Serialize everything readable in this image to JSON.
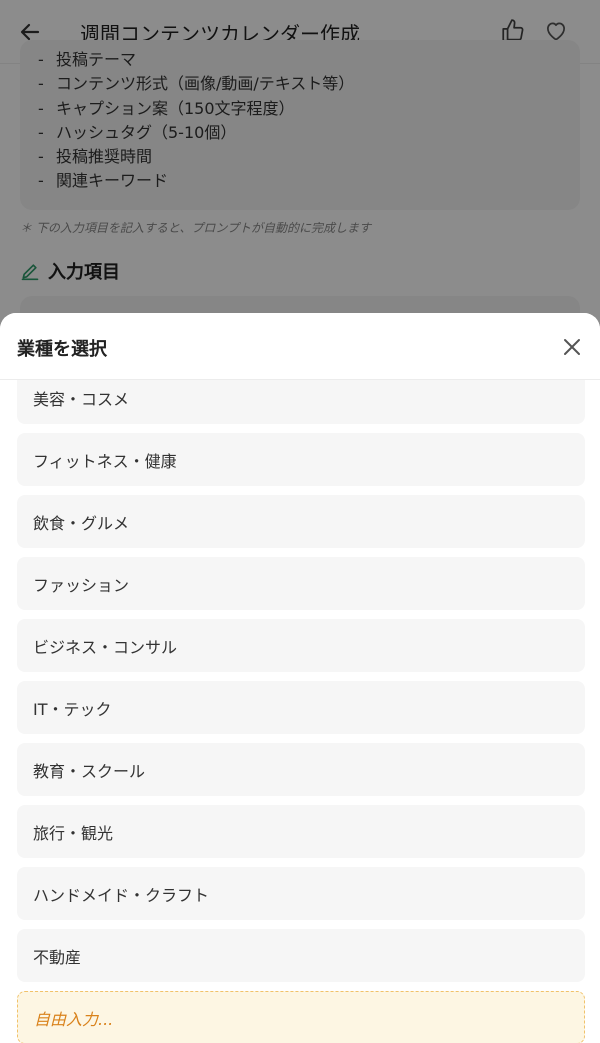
{
  "header": {
    "title": "週間コンテンツカレンダー作成"
  },
  "card": {
    "items": [
      "投稿テーマ",
      "コンテンツ形式（画像/動画/テキスト等）",
      "キャプション案（150文字程度）",
      "ハッシュタグ（5-10個）",
      "投稿推奨時間",
      "関連キーワード"
    ]
  },
  "hint": "下の入力項目を記入すると、プロンプトが自動的に完成します",
  "section": {
    "title": "入力項目"
  },
  "sheet": {
    "title": "業種を選択",
    "options": [
      "美容・コスメ",
      "フィットネス・健康",
      "飲食・グルメ",
      "ファッション",
      "ビジネス・コンサル",
      "IT・テック",
      "教育・スクール",
      "旅行・観光",
      "ハンドメイド・クラフト",
      "不動産"
    ],
    "free_input": "自由入力..."
  },
  "colors": {
    "accent_green": "#2e9b6a",
    "free_border": "#f1c26a",
    "free_text": "#d9821b"
  }
}
